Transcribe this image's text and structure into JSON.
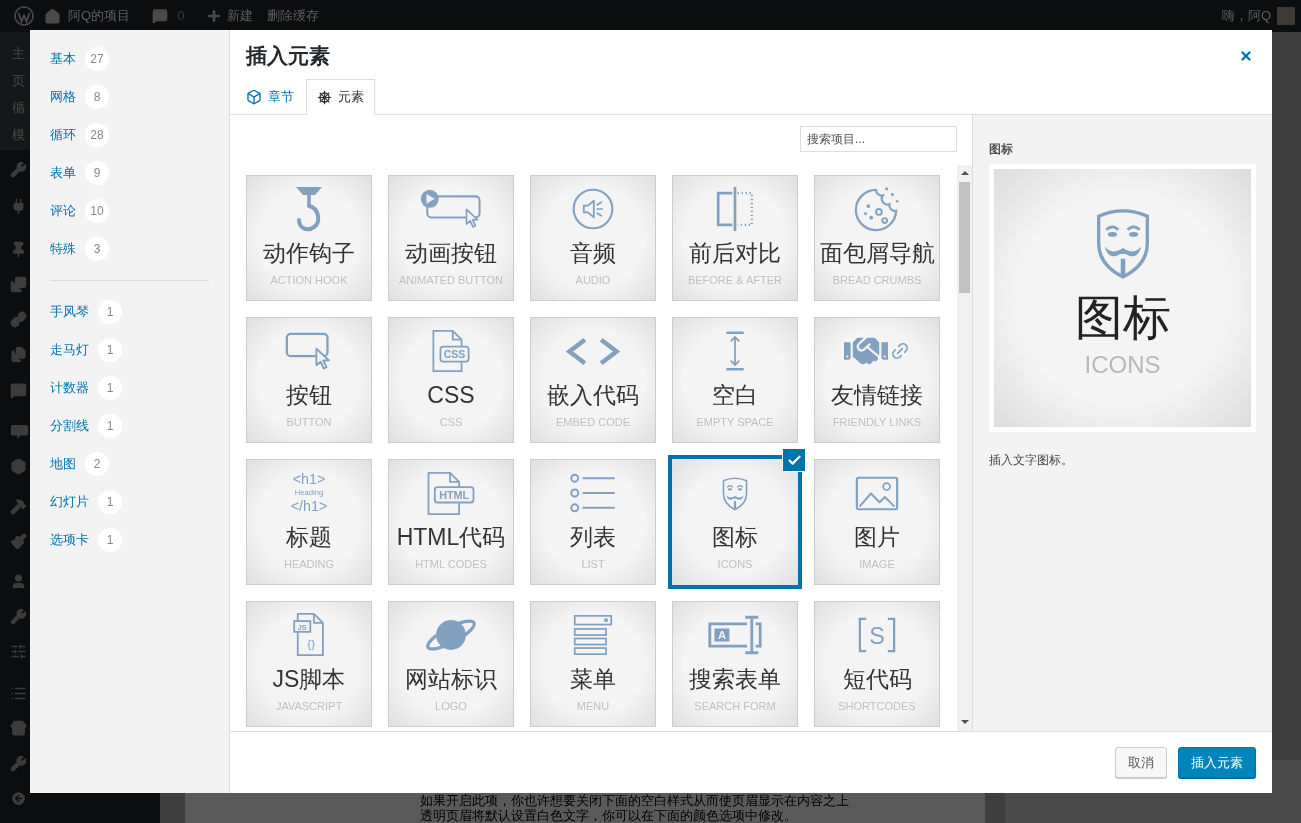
{
  "admin_bar": {
    "site": "阿Q的项目",
    "comments": "0",
    "new": "新建",
    "clear_cache": "删除缓存",
    "greeting": "嗨，阿Q"
  },
  "admin_menu": {
    "submenu": [
      "主",
      "页",
      "循",
      "模"
    ]
  },
  "page": {
    "lines": [
      "如果开启此项，你也许想要关闭下面的空白样式从而使页眉显示在内容之上",
      "透明页眉将默认设置白色文字，你可以在下面的颜色选项中修改。"
    ]
  },
  "modal": {
    "categories": [
      {
        "label": "基本",
        "count": "27"
      },
      {
        "label": "网格",
        "count": "8"
      },
      {
        "label": "循环",
        "count": "28"
      },
      {
        "label": "表单",
        "count": "9"
      },
      {
        "label": "评论",
        "count": "10"
      },
      {
        "label": "特殊",
        "count": "3"
      }
    ],
    "categories_more": [
      {
        "label": "手风琴",
        "count": "1"
      },
      {
        "label": "走马灯",
        "count": "1"
      },
      {
        "label": "计数器",
        "count": "1"
      },
      {
        "label": "分割线",
        "count": "1"
      },
      {
        "label": "地图",
        "count": "2"
      },
      {
        "label": "幻灯片",
        "count": "1"
      },
      {
        "label": "选项卡",
        "count": "1"
      }
    ],
    "title": "插入元素",
    "tabs": [
      {
        "label": "章节",
        "kind": "section",
        "selected": false
      },
      {
        "label": "元素",
        "kind": "element",
        "selected": true
      }
    ],
    "search": {
      "placeholder": "搜索项目..."
    },
    "elements": [
      {
        "kind": "hook",
        "title": "动作钩子",
        "subtitle": "ACTION HOOK",
        "selected": false
      },
      {
        "kind": "animbutton",
        "title": "动画按钮",
        "subtitle": "ANIMATED BUTTON",
        "selected": false
      },
      {
        "kind": "audio",
        "title": "音频",
        "subtitle": "AUDIO",
        "selected": false
      },
      {
        "kind": "compare",
        "title": "前后对比",
        "subtitle": "BEFORE & AFTER",
        "selected": false
      },
      {
        "kind": "breadcrumbs",
        "title": "面包屑导航",
        "subtitle": "BREAD CRUMBS",
        "selected": false
      },
      {
        "kind": "button",
        "title": "按钮",
        "subtitle": "BUTTON",
        "selected": false
      },
      {
        "kind": "css",
        "title": "CSS",
        "subtitle": "CSS",
        "selected": false,
        "icon_text": [
          "CSS"
        ]
      },
      {
        "kind": "embed",
        "title": "嵌入代码",
        "subtitle": "EMBED CODE",
        "selected": false
      },
      {
        "kind": "spacer",
        "title": "空白",
        "subtitle": "EMPTY SPACE",
        "selected": false
      },
      {
        "kind": "links",
        "title": "友情链接",
        "subtitle": "FRIENDLY LINKS",
        "selected": false
      },
      {
        "kind": "heading",
        "title": "标题",
        "subtitle": "HEADING",
        "selected": false,
        "icon_text": [
          "<h1>",
          "Heading",
          "</h1>"
        ]
      },
      {
        "kind": "html",
        "title": "HTML代码",
        "subtitle": "HTML CODES",
        "selected": false,
        "icon_text": [
          "HTML"
        ]
      },
      {
        "kind": "list",
        "title": "列表",
        "subtitle": "LIST",
        "selected": false
      },
      {
        "kind": "icons",
        "title": "图标",
        "subtitle": "ICONS",
        "selected": true
      },
      {
        "kind": "image",
        "title": "图片",
        "subtitle": "IMAGE",
        "selected": false
      },
      {
        "kind": "javascript",
        "title": "JS脚本",
        "subtitle": "JAVASCRIPT",
        "selected": false,
        "icon_text": [
          "JS",
          "{}"
        ]
      },
      {
        "kind": "logo",
        "title": "网站标识",
        "subtitle": "LOGO",
        "selected": false
      },
      {
        "kind": "menu",
        "title": "菜单",
        "subtitle": "MENU",
        "selected": false
      },
      {
        "kind": "searchform",
        "title": "搜索表单",
        "subtitle": "SEARCH FORM",
        "selected": false,
        "icon_text": [
          "A"
        ]
      },
      {
        "kind": "shortcode",
        "title": "短代码",
        "subtitle": "SHORTCODES",
        "selected": false,
        "icon_text": [
          "S"
        ]
      }
    ],
    "preview": {
      "heading": "图标",
      "kind": "icons",
      "title": "图标",
      "subtitle": "ICONS",
      "description": "插入文字图标。"
    },
    "buttons": {
      "cancel": "取消",
      "insert": "插入元素"
    }
  }
}
